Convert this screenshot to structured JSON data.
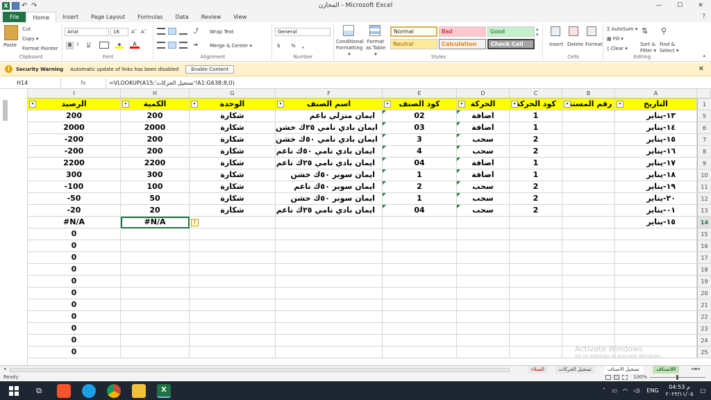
{
  "window": {
    "title": "المخازن  -  Microsoft Excel",
    "min": "—",
    "max": "☐",
    "close": "✕",
    "restore": "❐"
  },
  "tabs": [
    "File",
    "Home",
    "Insert",
    "Page Layout",
    "Formulas",
    "Data",
    "Review",
    "View"
  ],
  "ribbon": {
    "clipboard": {
      "paste": "Paste",
      "cut": "Cut",
      "copy": "Copy ▾",
      "format_painter": "Format Painter",
      "label": "Clipboard"
    },
    "font": {
      "name": "Arial",
      "size": "16",
      "label": "Font",
      "grow": "A˄",
      "shrink": "A˅",
      "bold": "B",
      "italic": "I",
      "underline": "U"
    },
    "alignment": {
      "wrap": "Wrap Text",
      "merge": "Merge & Center ▾",
      "label": "Alignment"
    },
    "number": {
      "format": "General",
      "currency": "$",
      "percent": "%",
      "comma": "❟",
      "label": "Number"
    },
    "styles": {
      "conditional": "Conditional Formatting ▾",
      "format_table": "Format as Table ▾",
      "normal": "Normal",
      "bad": "Bad",
      "good": "Good",
      "neutral": "Neutral",
      "calculation": "Calculation",
      "check": "Check Cell",
      "label": "Styles"
    },
    "cells": {
      "insert": "Insert",
      "delete": "Delete",
      "format": "Format",
      "label": "Cells"
    },
    "editing": {
      "autosum": "AutoSum ▾",
      "fill": "Fill ▾",
      "clear": "Clear ▾",
      "sort": "Sort & Filter ▾",
      "find": "Find & Select ▾",
      "label": "Editing"
    }
  },
  "security": {
    "title": "Security Warning",
    "message": "Automatic update of links has been disabled",
    "button": "Enable Content"
  },
  "formula_bar": {
    "name_box": "H14",
    "fx": "fx",
    "formula": "=VLOOKUP(A15;'تسجيل الحركات'!A1:G638;8;0)"
  },
  "columns": [
    "I",
    "H",
    "G",
    "F",
    "E",
    "D",
    "C",
    "B",
    "A"
  ],
  "headers": [
    "الرصيد",
    "الكمية",
    "الوحدة",
    "اسم الصنف",
    "كود الصنف",
    "الحركة",
    "كود الحركة",
    "رقم المستند",
    "التاريخ"
  ],
  "rows": [
    [
      "200",
      "200",
      "شكارة",
      "ايمان منزلي ناعم",
      "02",
      "اضافة",
      "1",
      "",
      "١٣-يناير"
    ],
    [
      "2000",
      "2000",
      "شكارة",
      "ايمان بادي نامي ٢٥ك خشن",
      "03",
      "اضافة",
      "1",
      "",
      "١٤-يناير"
    ],
    [
      "-200",
      "200",
      "شكارة",
      "ايمان بادي نامي ٥٠ك خشن",
      "3",
      "سحب",
      "2",
      "",
      "١٥-يناير"
    ],
    [
      "-200",
      "200",
      "شكارة",
      "ايمان بادي نامي ٥٠ك ناعم",
      "4",
      "سحب",
      "2",
      "",
      "١٦-يناير"
    ],
    [
      "2200",
      "2200",
      "شكارة",
      "ايمان بادي نامي ٢٥ك ناعم",
      "04",
      "اضافة",
      "1",
      "",
      "١٧-يناير"
    ],
    [
      "300",
      "300",
      "شكارة",
      "ايمان سوبر ٥٠ك خشن",
      "1",
      "اضافة",
      "1",
      "",
      "١٨-يناير"
    ],
    [
      "-100",
      "100",
      "شكارة",
      "ايمان سوبر ٥٠ك ناعم",
      "2",
      "سحب",
      "2",
      "",
      "١٩-يناير"
    ],
    [
      "-50",
      "50",
      "شكارة",
      "ايمان سوبر ٥٠ك خشن",
      "1",
      "سحب",
      "2",
      "",
      "٢٠-يناير"
    ],
    [
      "-20",
      "20",
      "شكارة",
      "ايمان بادي نامي ٢٥ك ناعم",
      "04",
      "سحب",
      "2",
      "",
      "٠١-يناير"
    ],
    [
      "#N/A",
      "#N/A",
      "",
      "",
      "",
      "",
      "",
      "",
      "١٥-يناير"
    ]
  ],
  "row_numbers": [
    "1",
    "5",
    "6",
    "7",
    "8",
    "9",
    "10",
    "11",
    "12",
    "13",
    "14",
    "15",
    "16",
    "17",
    "18",
    "19",
    "20",
    "21",
    "22",
    "23",
    "24",
    "25"
  ],
  "zero": "0",
  "sheet_tabs": [
    "الاصناف",
    "تسجيل الاصناف",
    "تسجيل الحركات",
    "العملاء"
  ],
  "status": {
    "ready": "Ready",
    "zoom": "100%"
  },
  "watermark": {
    "line1": "Activate Windows",
    "line2": "Go to Settings to activate Windows."
  },
  "tray": {
    "lang": "ENG",
    "time": "04:53 م",
    "date": "٢٠٢٣/١١/٠٥"
  }
}
